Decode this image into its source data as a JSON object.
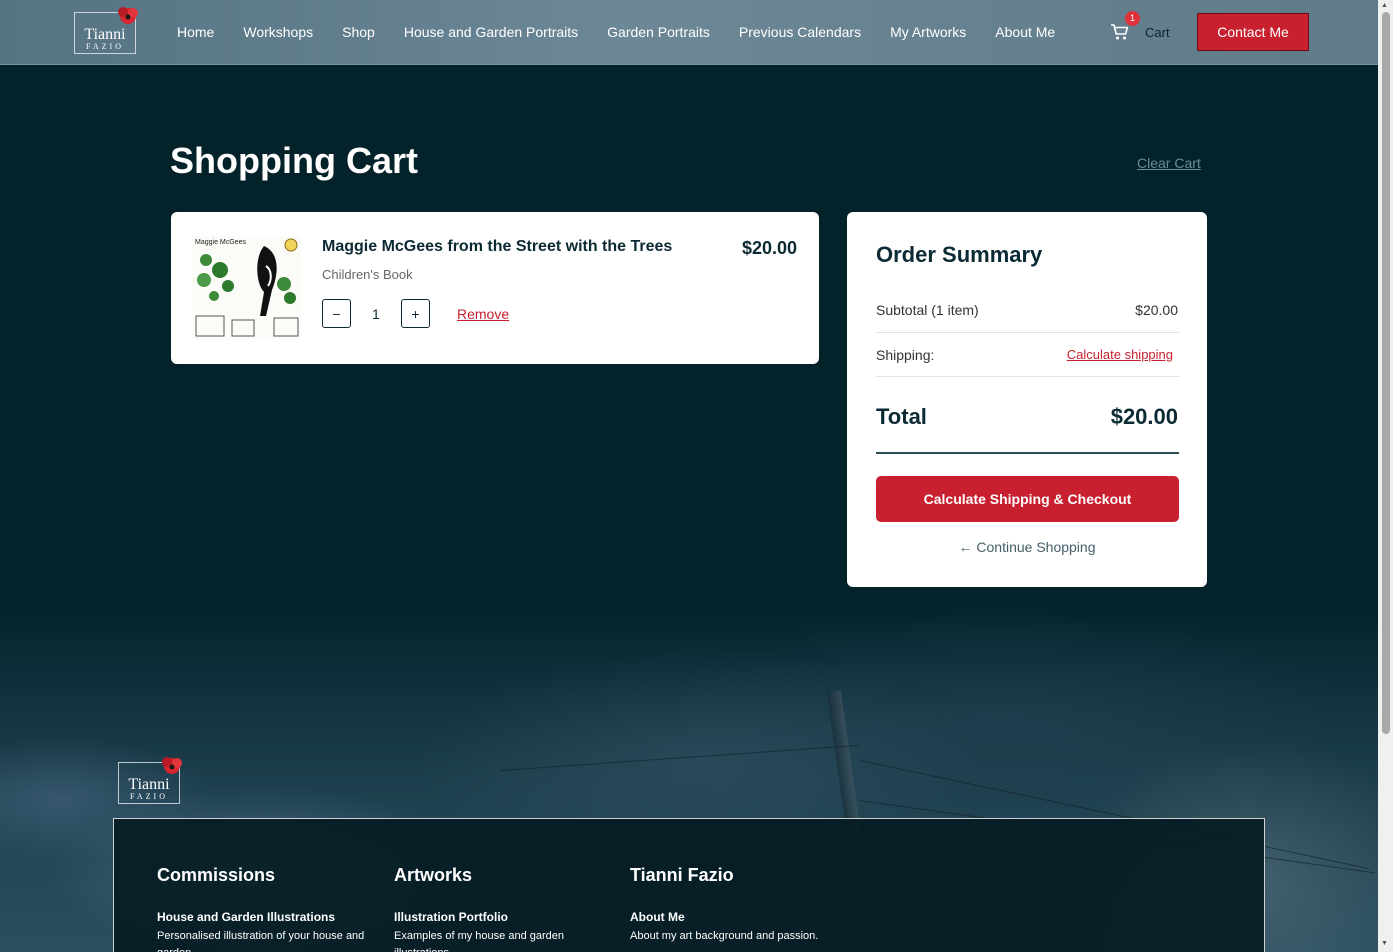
{
  "brand": {
    "logo_line1": "Tianni",
    "logo_line2": "FAZIO"
  },
  "nav": {
    "items": [
      "Home",
      "Workshops",
      "Shop",
      "House and Garden Portraits",
      "Garden Portraits",
      "Previous Calendars",
      "My Artworks",
      "About Me"
    ]
  },
  "cart": {
    "badge": "1",
    "label": "Cart"
  },
  "contact_label": "Contact Me",
  "page": {
    "title": "Shopping Cart",
    "clear_cart": "Clear Cart"
  },
  "item": {
    "title": "Maggie McGees from the Street with the Trees",
    "category": "Children's Book",
    "quantity": "1",
    "price": "$20.00",
    "minus": "−",
    "plus": "+",
    "remove": "Remove",
    "thumb_text": "Maggie McGees"
  },
  "summary": {
    "title": "Order Summary",
    "subtotal_label": "Subtotal (1 item)",
    "subtotal_value": "$20.00",
    "shipping_label": "Shipping:",
    "shipping_link": "Calculate shipping",
    "total_label": "Total",
    "total_value": "$20.00",
    "checkout": "Calculate Shipping & Checkout",
    "continue": "← Continue Shopping"
  },
  "footer": {
    "columns": [
      {
        "heading": "Commissions",
        "sub": "House and Garden Illustrations",
        "desc": "Personalised illustration of your house and garden"
      },
      {
        "heading": "Artworks",
        "sub": "Illustration Portfolio",
        "desc": "Examples of my house and garden illustrations"
      },
      {
        "heading": "Tianni Fazio",
        "sub": "About Me",
        "desc": "About my art background and passion."
      }
    ]
  },
  "colors": {
    "accent": "#c8202f",
    "dark_bg": "#03222a",
    "header": "#6c8796"
  }
}
